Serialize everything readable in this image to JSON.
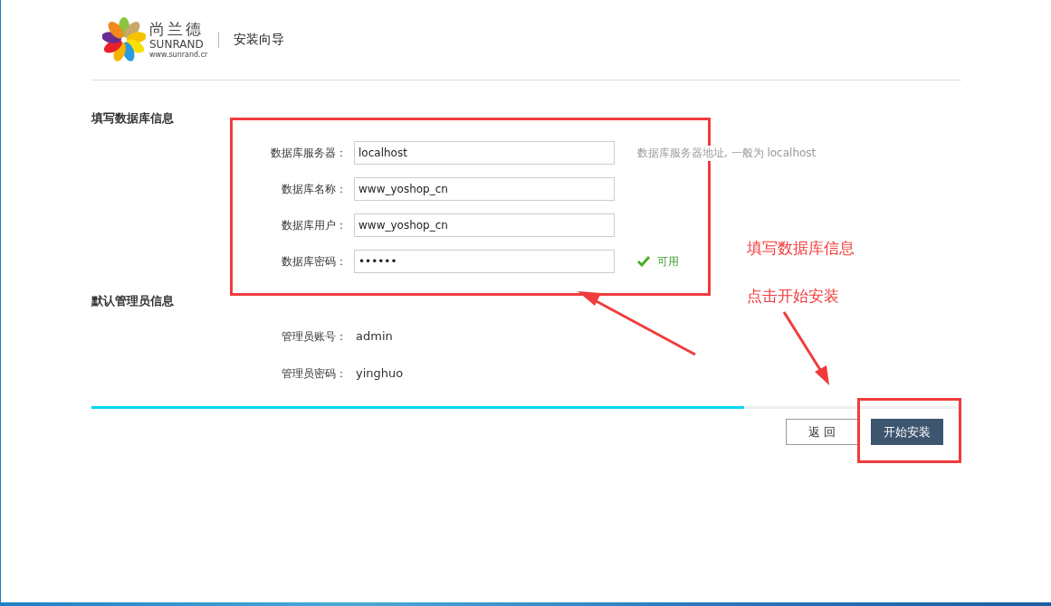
{
  "header": {
    "brand_cn": "尚兰德",
    "brand_en": "SUNRAND",
    "brand_url": "www.sunrand.cr",
    "title": "安装向导"
  },
  "database": {
    "title": "填写数据库信息",
    "fields": [
      {
        "label": "数据库服务器：",
        "value": "localhost",
        "hint": "数据库服务器地址, 一般为 localhost"
      },
      {
        "label": "数据库名称：",
        "value": "www_yoshop_cn"
      },
      {
        "label": "数据库用户：",
        "value": "www_yoshop_cn"
      },
      {
        "label": "数据库密码：",
        "value": "••••••",
        "status": "可用"
      }
    ]
  },
  "admin": {
    "title": "默认管理员信息",
    "rows": [
      {
        "label": "管理员账号：",
        "value": "admin"
      },
      {
        "label": "管理员密码：",
        "value": "yinghuo"
      }
    ]
  },
  "progress": {
    "level": 0.75
  },
  "buttons": [
    {
      "label": "返 回",
      "kind": "secondary"
    },
    {
      "label": "开始安装",
      "kind": "primary"
    }
  ],
  "annotations": [
    "填写数据库信息",
    "点击开始安装"
  ]
}
